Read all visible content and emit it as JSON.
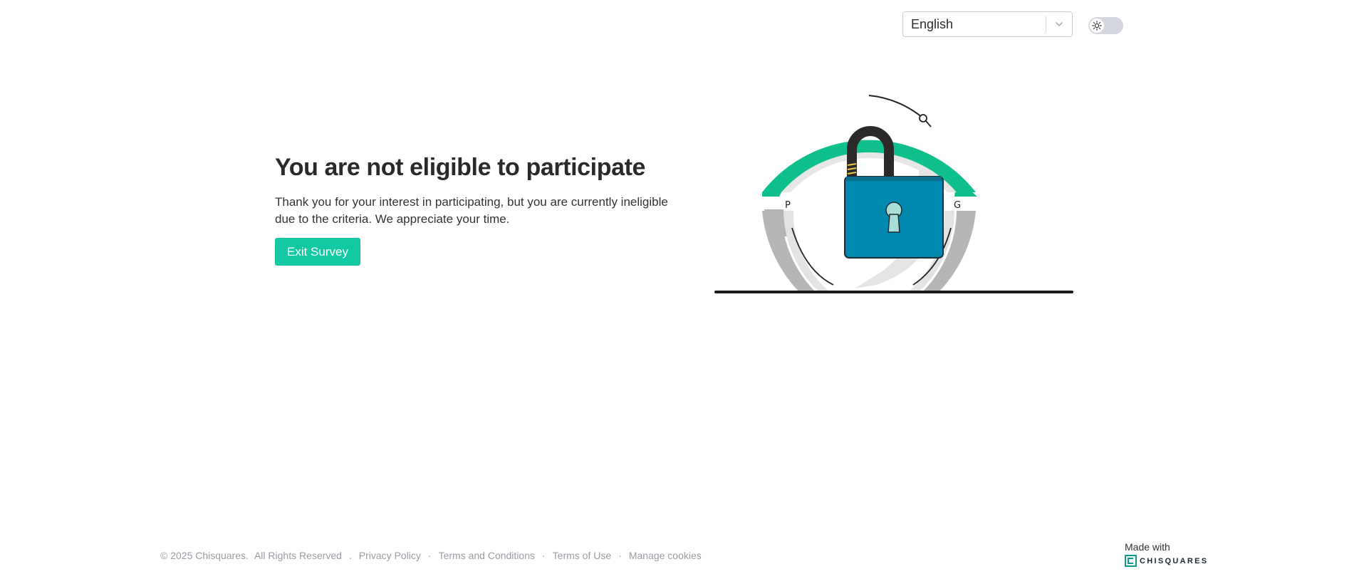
{
  "header": {
    "language_select": {
      "value": "English"
    },
    "theme_toggle": {
      "state": "light"
    }
  },
  "main": {
    "title": "You are not eligible to participate",
    "message": "Thank you for your interest in participating, but you are currently ineligible due to the criteria. We appreciate your time.",
    "exit_label": "Exit Survey"
  },
  "illustration": {
    "left_letter": "P",
    "right_letter": "G"
  },
  "footer": {
    "copyright": "© 2025 Chisquares.",
    "rights": "All Rights Reserved",
    "sep1": ".",
    "privacy": "Privacy Policy",
    "terms_conditions": "Terms and Conditions",
    "terms_use": "Terms of Use",
    "manage_cookies": "Manage cookies",
    "dot": "·",
    "made_with": "Made with",
    "brand_name": "CHISQUARES"
  },
  "colors": {
    "accent": "#13c9a3",
    "lock_body": "#0189b0",
    "ring_green": "#0fc08c"
  }
}
